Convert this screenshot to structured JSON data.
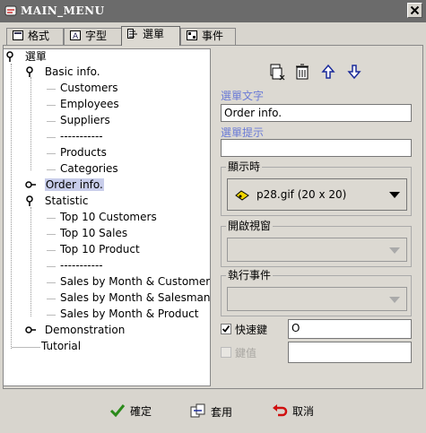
{
  "window": {
    "title": "MAIN_MENU"
  },
  "tabs": [
    {
      "label": "格式",
      "icon": "format-icon"
    },
    {
      "label": "字型",
      "icon": "font-icon"
    },
    {
      "label": "選單",
      "icon": "menu-icon",
      "active": true
    },
    {
      "label": "事件",
      "icon": "event-icon"
    }
  ],
  "tree": {
    "root": "選單",
    "items": [
      "Basic info.",
      "Customers",
      "Employees",
      "Suppliers",
      "-----------",
      "Products",
      "Categories",
      "Order info.",
      "Statistic",
      "Top 10 Customers",
      "Top 10 Sales",
      "Top 10 Product",
      "-----------",
      "Sales by Month & Customer",
      "Sales by Month & Salesman",
      "Sales by Month & Product",
      "Demonstration",
      "Tutorial"
    ],
    "selected": "Order info."
  },
  "toolbar": {
    "icons": [
      "add-item-icon",
      "delete-icon",
      "move-up-icon",
      "move-down-icon"
    ]
  },
  "form": {
    "menu_text_label": "選單文字",
    "menu_text_value": "Order info.",
    "menu_hint_label": "選單提示",
    "menu_hint_value": "",
    "display_group_label": "顯示時",
    "display_value": "p28.gif  (20 x 20)",
    "open_window_label": "開啟視窗",
    "open_window_value": "",
    "exec_event_label": "執行事件",
    "exec_event_value": "",
    "shortcut_label": "快速鍵",
    "shortcut_checked": true,
    "shortcut_value": "O",
    "key_value_label": "鍵值",
    "key_value_checked": false,
    "key_value_value": ""
  },
  "buttons": {
    "ok": "確定",
    "apply": "套用",
    "cancel": "取消"
  }
}
